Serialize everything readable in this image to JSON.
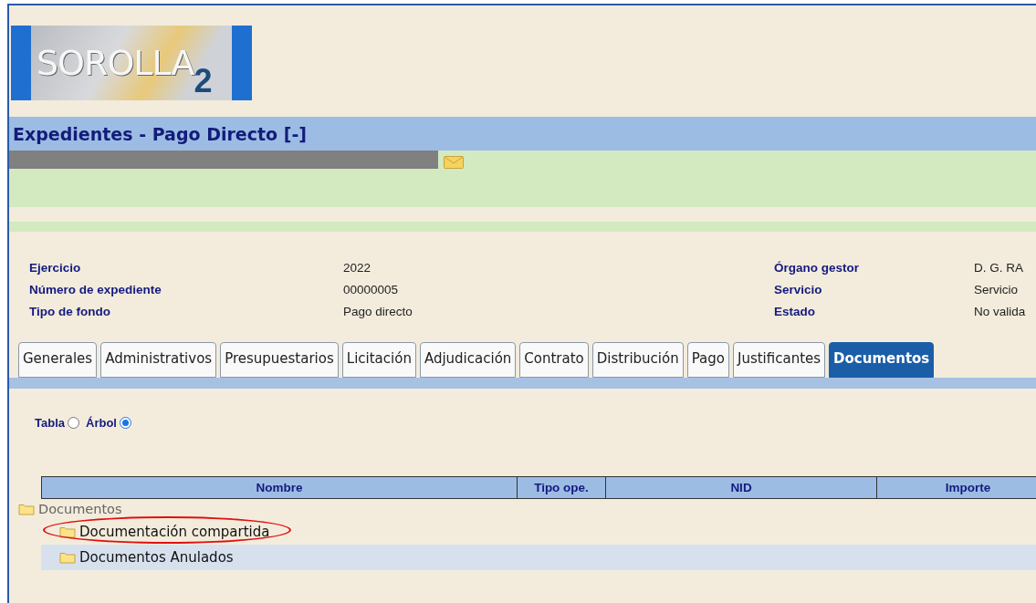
{
  "logo": {
    "text": "SOROLLA",
    "suffix": "2"
  },
  "title": "Expedientes - Pago Directo [-]",
  "info": [
    {
      "label": "Ejercicio",
      "value": "2022",
      "label2": "Órgano gestor",
      "value2": "D. G. RA"
    },
    {
      "label": "Número de expediente",
      "value": "00000005",
      "label2": "Servicio",
      "value2": "Servicio"
    },
    {
      "label": "Tipo de fondo",
      "value": "Pago directo",
      "label2": "Estado",
      "value2": "No valida"
    }
  ],
  "tabs": [
    {
      "label": "Generales",
      "selected": false
    },
    {
      "label": "Administrativos",
      "selected": false
    },
    {
      "label": "Presupuestarios",
      "selected": false
    },
    {
      "label": "Licitación",
      "selected": false
    },
    {
      "label": "Adjudicación",
      "selected": false
    },
    {
      "label": "Contrato",
      "selected": false
    },
    {
      "label": "Distribución",
      "selected": false
    },
    {
      "label": "Pago",
      "selected": false
    },
    {
      "label": "Justificantes",
      "selected": false
    },
    {
      "label": "Documentos",
      "selected": true
    }
  ],
  "view_options": [
    {
      "label": "Tabla",
      "selected": false
    },
    {
      "label": "Árbol",
      "selected": true
    }
  ],
  "table": {
    "columns": [
      "Nombre",
      "Tipo ope.",
      "NID",
      "Importe"
    ]
  },
  "tree": [
    {
      "label": "Documentos",
      "children": [
        {
          "label": "Documentación compartida",
          "highlighted": true
        },
        {
          "label": "Documentos Anulados",
          "highlighted": false
        }
      ]
    }
  ]
}
